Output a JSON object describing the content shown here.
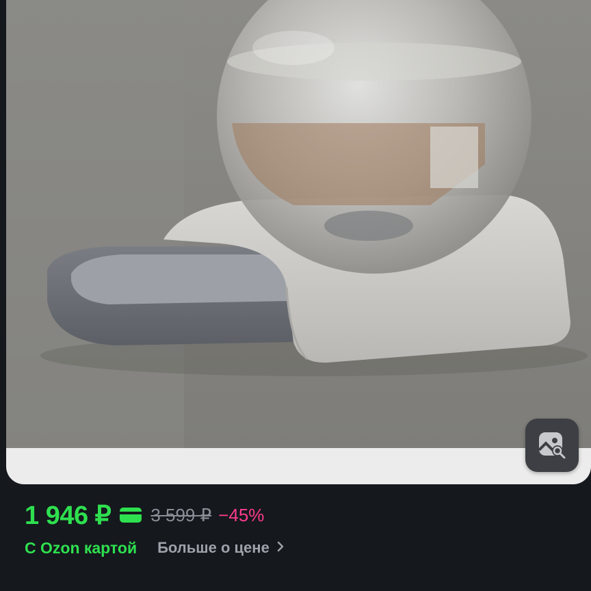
{
  "product": {
    "image_alt": "Автоматическая поилка для животных с шаровидным резервуаром",
    "price": {
      "current": "1 946 ₽",
      "old": "3 599 ₽",
      "discount": "−45%"
    },
    "ozon_card_label": "С Ozon картой",
    "more_about_price": "Больше о цене"
  },
  "icons": {
    "card": "bank-card-icon",
    "visual_search": "image-search-icon",
    "chevron": "chevron-right-icon"
  },
  "colors": {
    "background": "#15181d",
    "price_green": "#2ee04f",
    "discount_pink": "#ff3b8e",
    "muted_gray": "#8a8e96"
  }
}
